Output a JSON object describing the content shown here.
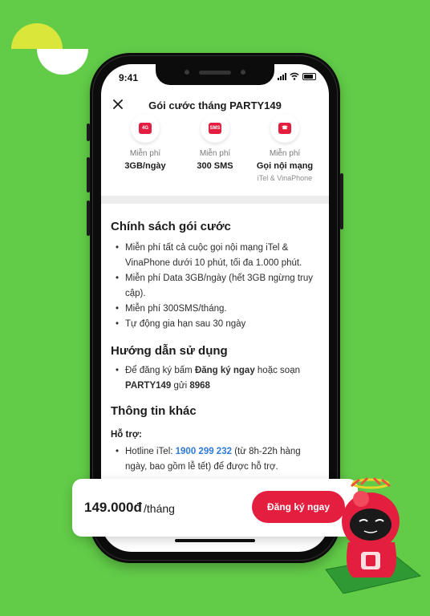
{
  "status_bar": {
    "time": "9:41"
  },
  "header": {
    "title": "Gói cước tháng PARTY149"
  },
  "features": [
    {
      "icon": "data-gift-icon",
      "top": "Miễn phí",
      "main": "3GB/ngày",
      "sub": ""
    },
    {
      "icon": "sms-icon",
      "top": "Miễn phí",
      "main": "300 SMS",
      "sub": ""
    },
    {
      "icon": "phone-call-icon",
      "top": "Miễn phí",
      "main": "Gọi nội mạng",
      "sub": "iTel & VinaPhone"
    }
  ],
  "policy": {
    "title": "Chính sách gói cước",
    "items": [
      "Miễn phí tất cả cuộc gọi nội mạng iTel & VinaPhone dưới 10 phút, tối đa 1.000 phút.",
      "Miễn phí Data 3GB/ngày (hết 3GB ngừng truy cập).",
      "Miễn phí 300SMS/tháng.",
      "Tự động gia hạn sau 30 ngày"
    ]
  },
  "guide": {
    "title": "Hướng dẫn sử dụng",
    "item_prefix": "Để đăng ký bấm ",
    "item_bold1": "Đăng ký ngay",
    "item_mid": " hoặc soạn ",
    "item_bold2": "PARTY149",
    "item_mid2": " gửi ",
    "item_bold3": "8968"
  },
  "other": {
    "title": "Thông tin khác",
    "support_label": "Hỗ trợ:",
    "hotline_prefix": "Hotline iTel: ",
    "hotline_number": "1900 299 232",
    "hotline_suffix": " (từ 8h-22h hàng ngày, bao gồm lễ tết) để được hỗ trợ."
  },
  "price": {
    "value": "149.000đ",
    "unit": "/tháng"
  },
  "cta": {
    "label": "Đăng ký ngay"
  },
  "colors": {
    "brand": "#e41e3f",
    "background": "#62cc48",
    "link": "#2f7ad8"
  }
}
